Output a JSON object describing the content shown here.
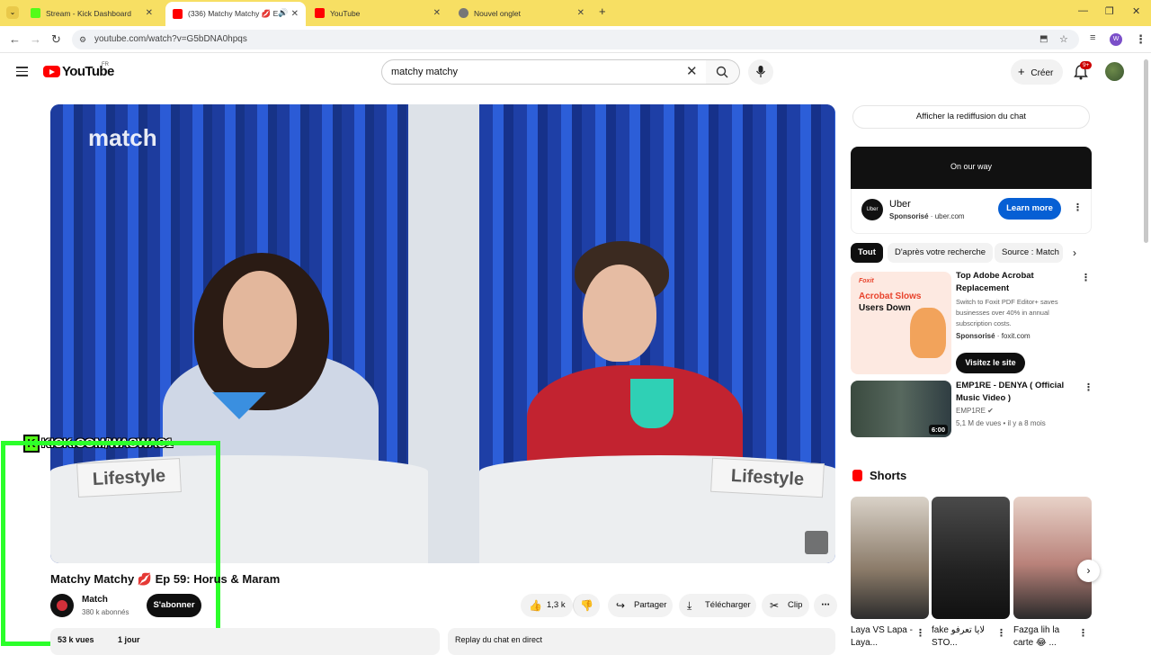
{
  "browser": {
    "tabs": [
      {
        "title": "Stream - Kick Dashboard",
        "favicon_color": "#53fc18"
      },
      {
        "title": "(336) Matchy Matchy 💋 Ep",
        "favicon_color": "#ff0000"
      },
      {
        "title": "YouTube",
        "favicon_color": "#ff0000"
      },
      {
        "title": "Nouvel onglet",
        "favicon_color": "#777777"
      }
    ],
    "url": "youtube.com/watch?v=G5bDNA0hpqs",
    "profile_initial": "W",
    "tab_bar_color": "#f7df63"
  },
  "header": {
    "logo_text": "YouTube",
    "region": "FR",
    "search_value": "matchy matchy",
    "create_label": "Créer",
    "notif_badge": "9+"
  },
  "video": {
    "watermark": "match",
    "overlay_text": "KICK.COM/WASWAS1",
    "card_left": "Lifestyle",
    "card_right": "Lifestyle",
    "title": "Matchy Matchy 💋 Ep 59: Horus & Maram",
    "overlay_color": "#2bff2a"
  },
  "channel": {
    "name": "Match",
    "subscribers": "380 k abonnés",
    "subscribe_label": "S'abonner"
  },
  "actions": {
    "likes": "1,3 k",
    "share": "Partager",
    "download": "Télécharger",
    "clip": "Clip"
  },
  "description": {
    "stats": "53 k vues",
    "age": "1 jour",
    "replay_label": "Replay du chat en direct"
  },
  "sidebar": {
    "chat_replay_label": "Afficher la rediffusion du chat",
    "ad": {
      "banner_text": "On our way",
      "advertiser": "Uber",
      "sponsored": "Sponsorisé",
      "domain": "uber.com",
      "cta": "Learn more",
      "logo_text": "Uber"
    },
    "chips": [
      "Tout",
      "D'après votre recherche",
      "Source : Match"
    ],
    "promo": {
      "thumb_brand": "Foxit",
      "thumb_head_1": "Acrobat Slows",
      "thumb_head_2": "Users Down",
      "title": "Top Adobe Acrobat Replacement",
      "description": "Switch to Foxit PDF Editor+ saves businesses over 40% in annual subscription costs.",
      "sponsored": "Sponsorisé",
      "domain": "foxit.com",
      "cta": "Visitez le site"
    },
    "video": {
      "title": "EMP1RE - DENYA ( Official Music Video )",
      "channel": "EMP1RE",
      "views": "5,1 M de vues",
      "age": "il y a 8 mois",
      "duration": "6:00"
    },
    "shorts_label": "Shorts",
    "shorts": [
      {
        "title": "Laya VS Lapa - Laya..."
      },
      {
        "title": "fake لايا تعرفو STO..."
      },
      {
        "title": "Fazga lih la carte 😂 ..."
      }
    ]
  }
}
